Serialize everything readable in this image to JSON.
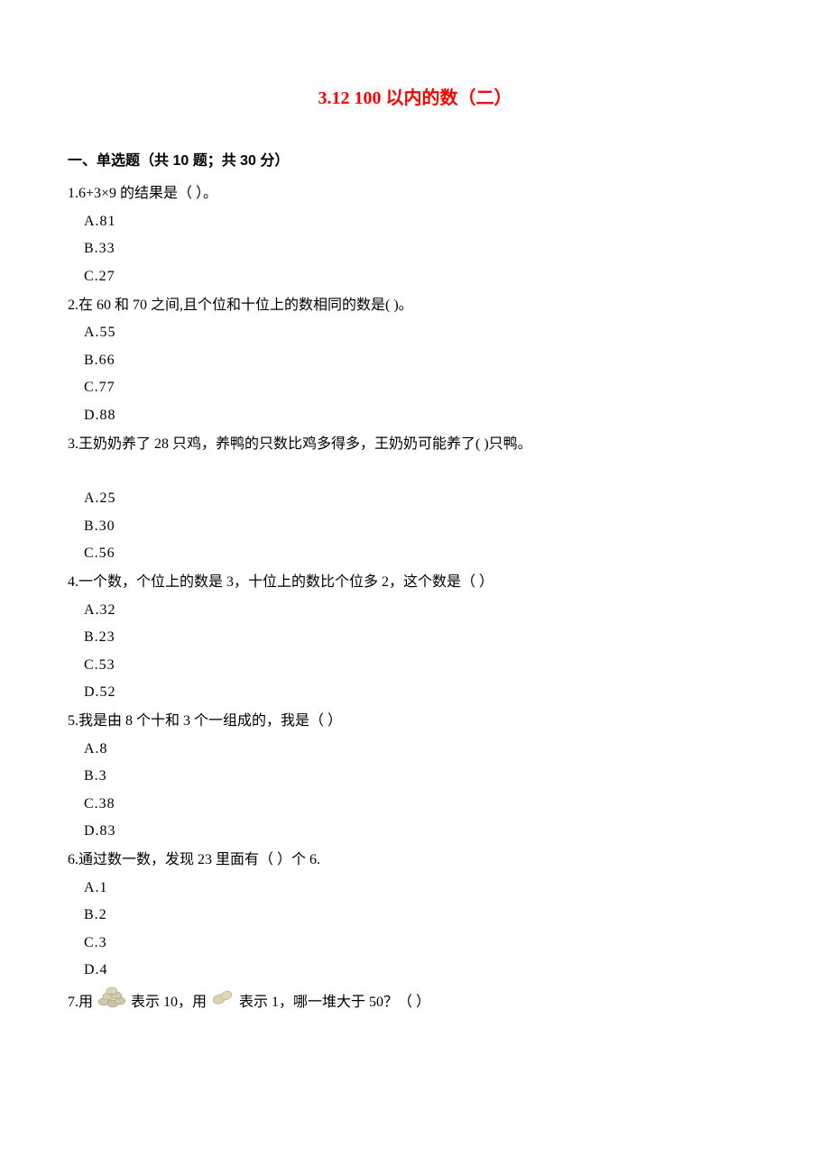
{
  "title": "3.12 100 以内的数（二）",
  "section": "一、单选题（共 10 题；共 30 分）",
  "questions": {
    "q1": {
      "text": "1.6+3×9 的结果是（      ）。",
      "a": "A.81",
      "b": "B.33",
      "c": "C.27"
    },
    "q2": {
      "text": "2.在 60 和 70 之间,且个位和十位上的数相同的数是(       )。",
      "a": "A.55",
      "b": "B.66",
      "c": "C.77",
      "d": "D.88"
    },
    "q3": {
      "text": "3.王奶奶养了 28 只鸡，养鸭的只数比鸡多得多，王奶奶可能养了(      )只鸭。",
      "a": "A.25",
      "b": "B.30",
      "c": "C.56"
    },
    "q4": {
      "text": "4.一个数，个位上的数是 3，十位上的数比个位多 2，这个数是（        ）",
      "a": "A.32",
      "b": "B.23",
      "c": "C.53",
      "d": "D.52"
    },
    "q5": {
      "text": "5.我是由 8 个十和 3 个一组成的，我是（         ）",
      "a": "A.8",
      "b": "B.3",
      "c": "C.38",
      "d": "D.83"
    },
    "q6": {
      "text": "6.通过数一数，发现 23 里面有（              ）个 6.",
      "a": "A.1",
      "b": "B.2",
      "c": "C.3",
      "d": "D.4"
    },
    "q7": {
      "prefix": "7.用 ",
      "mid1": " 表示 10，用 ",
      "mid2": " 表示 1，哪一堆大于 50？（   ）"
    }
  }
}
